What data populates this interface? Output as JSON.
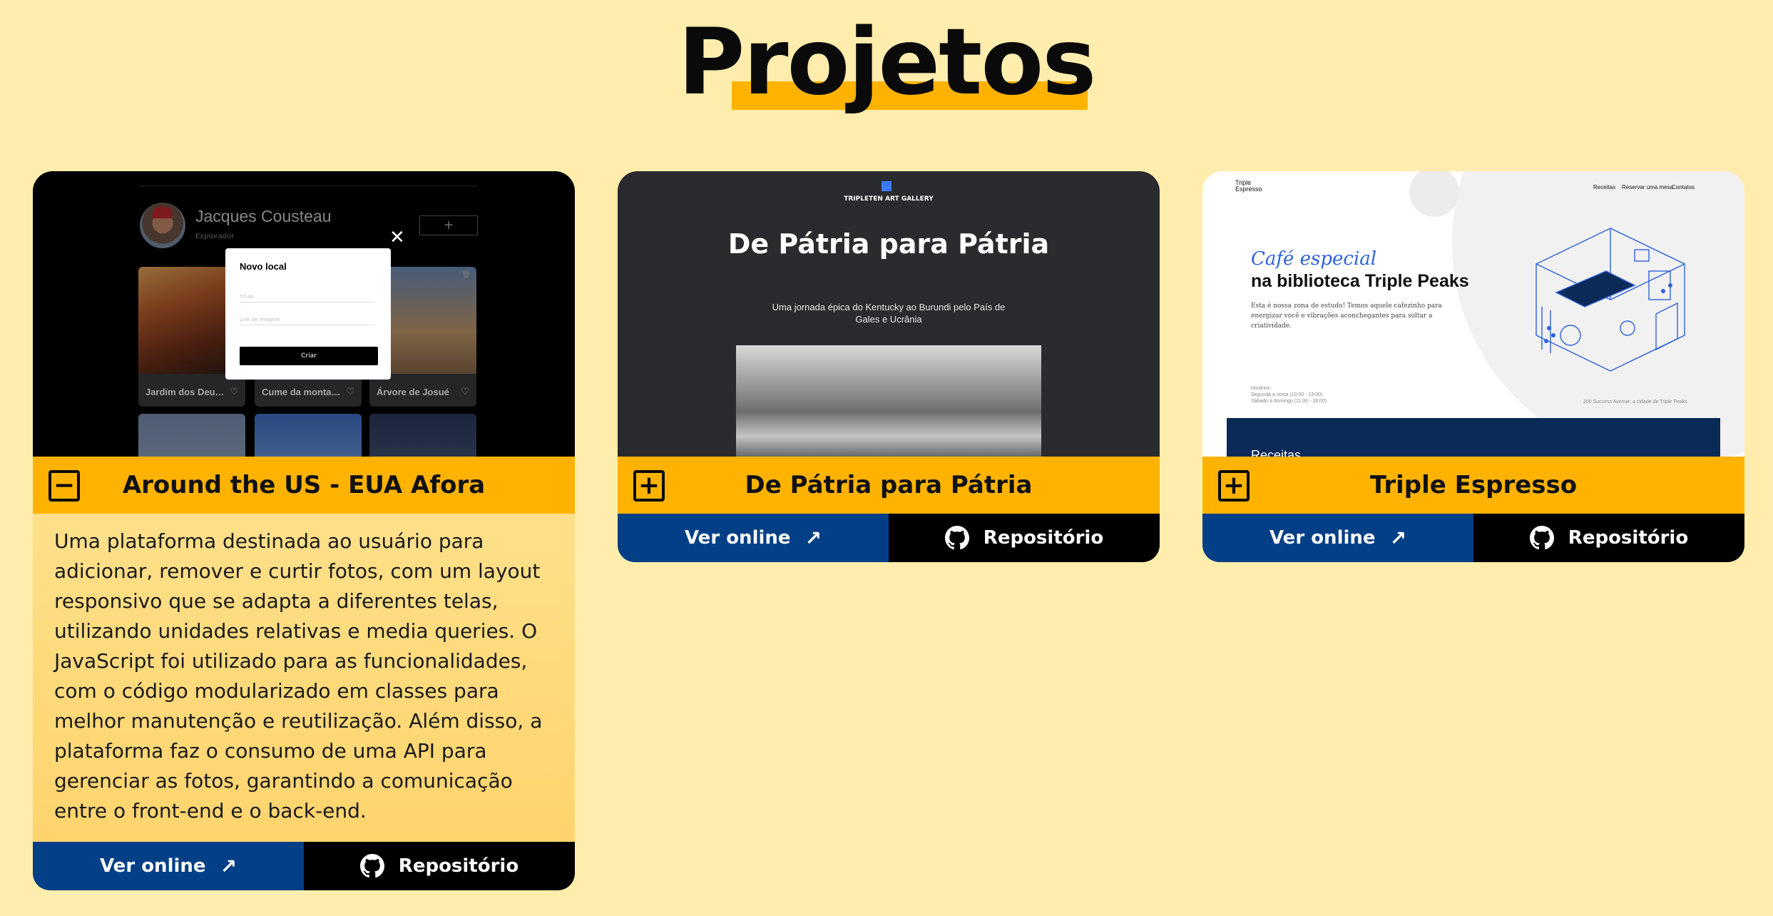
{
  "page": {
    "title": "Projetos"
  },
  "projects": [
    {
      "name": "Around the US - EUA Afora",
      "toggle": "−",
      "description": "Uma plataforma destinada ao usuário para adicionar, remover e curtir fotos, com um layout responsivo que se adapta a diferentes telas, utilizando unidades relativas e media queries. O JavaScript foi utilizado para as funcionalidades, com o código modularizado em classes para melhor manutenção e reutilização. Além disso, a plataforma faz o consumo de uma API para gerenciar as fotos, garantindo a comunicação entre o front-end e o back-end.",
      "online_label": "Ver online",
      "repo_label": "Repositório",
      "preview": {
        "user_name": "Jacques Cousteau",
        "user_role": "Explorador",
        "add_label": "+",
        "modal_title": "Novo local",
        "field_title_placeholder": "Título",
        "field_link_placeholder": "Link de imagem",
        "create_label": "Criar",
        "close": "✕",
        "cards": [
          "Jardim dos Deuses",
          "Cume da montanha",
          "Árvore de Josué"
        ]
      }
    },
    {
      "name": "De Pátria para Pátria",
      "toggle": "+",
      "online_label": "Ver online",
      "repo_label": "Repositório",
      "preview": {
        "gallery_name": "TRIPLETEN ART GALLERY",
        "hero_title": "De Pátria para Pátria",
        "hero_subtitle": "Uma jornada épica do Kentucky ao Burundi pelo País de Gales e Ucrânia"
      }
    },
    {
      "name": "Triple Espresso",
      "toggle": "+",
      "online_label": "Ver online",
      "repo_label": "Repositório",
      "preview": {
        "brand": "Triple Espresso",
        "nav": [
          "Receitas",
          "Reservar uma mesa",
          "Contatos"
        ],
        "headline_italic": "Café especial",
        "headline_bold": "na biblioteca Triple Peaks",
        "text": "Esta é nossa zona de estudo! Temos aquele cafezinho para energizar você e vibrações aconchegantes para soltar a criatividade.",
        "hours_title": "Horários:",
        "hours_weekday": "Segunda a sexta (10:00 - 19:00)",
        "hours_weekend": "Sábado a domingo (11:00 - 18:00)",
        "address": "200 Success Avenue, a cidade de Triple Peaks",
        "section_title": "Receitas"
      }
    }
  ],
  "colors": {
    "background": "#FFEDAD",
    "accent": "#FFB300",
    "online": "#033F86",
    "repo": "#000000"
  },
  "icons": {
    "online": "arrow-up-right-icon",
    "repo": "github-icon",
    "collapse": "minus-square-icon",
    "expand": "plus-square-icon"
  }
}
